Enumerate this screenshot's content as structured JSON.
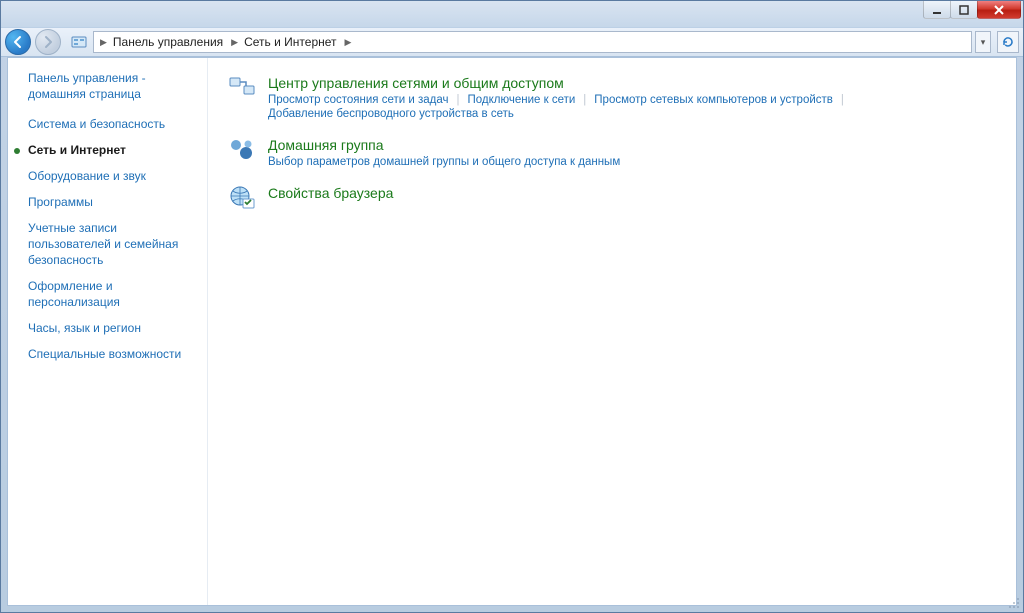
{
  "breadcrumb": {
    "items": [
      "Панель управления",
      "Сеть и Интернет"
    ]
  },
  "sidebar": {
    "home": "Панель управления - домашняя страница",
    "items": [
      {
        "label": "Система и безопасность",
        "active": false
      },
      {
        "label": "Сеть и Интернет",
        "active": true
      },
      {
        "label": "Оборудование и звук",
        "active": false
      },
      {
        "label": "Программы",
        "active": false
      },
      {
        "label": "Учетные записи пользователей и семейная безопасность",
        "active": false
      },
      {
        "label": "Оформление и персонализация",
        "active": false
      },
      {
        "label": "Часы, язык и регион",
        "active": false
      },
      {
        "label": "Специальные возможности",
        "active": false
      }
    ]
  },
  "categories": [
    {
      "icon": "network-sharing-icon",
      "title": "Центр управления сетями и общим доступом",
      "links": [
        "Просмотр состояния сети и задач",
        "Подключение к сети",
        "Просмотр сетевых компьютеров и устройств",
        "Добавление беспроводного устройства в сеть"
      ]
    },
    {
      "icon": "homegroup-icon",
      "title": "Домашняя группа",
      "links": [
        "Выбор параметров домашней группы и общего доступа к данным"
      ]
    },
    {
      "icon": "internet-options-icon",
      "title": "Свойства браузера",
      "links": []
    }
  ]
}
